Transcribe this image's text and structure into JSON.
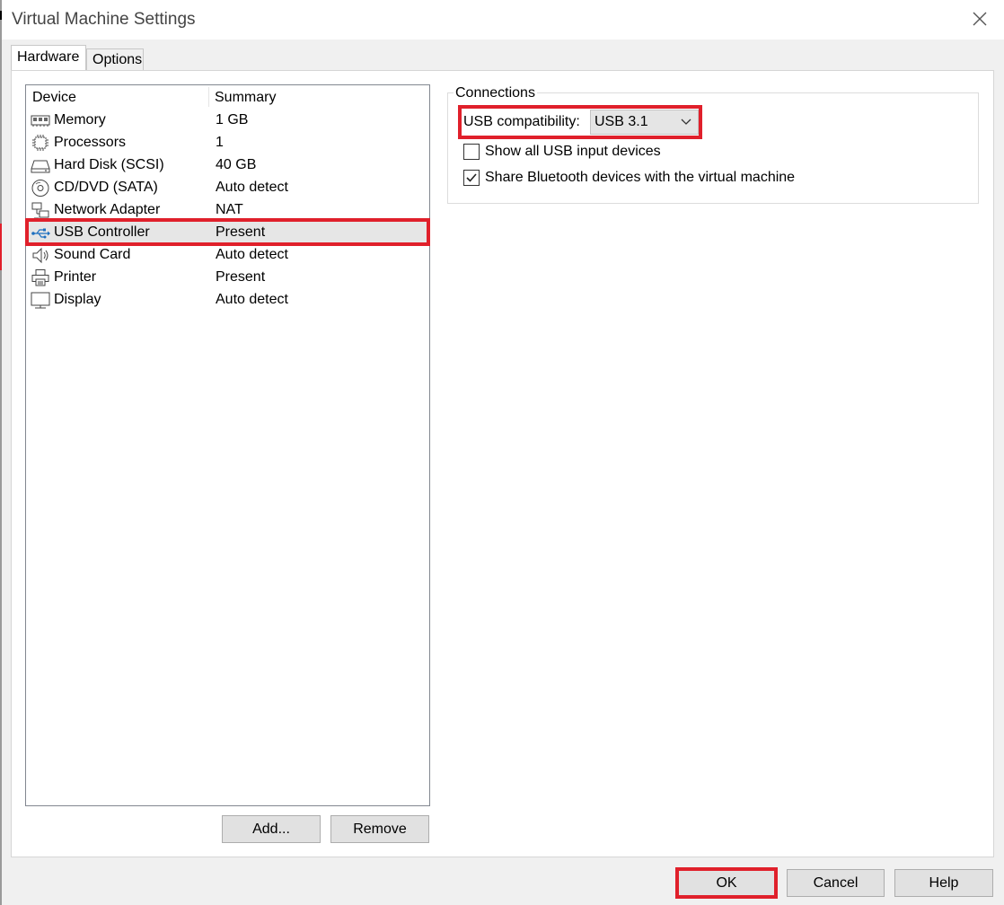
{
  "window": {
    "title": "Virtual Machine Settings"
  },
  "tabs": [
    {
      "label": "Hardware",
      "active": true
    },
    {
      "label": "Options",
      "active": false
    }
  ],
  "device_list": {
    "columns": [
      "Device",
      "Summary"
    ],
    "rows": [
      {
        "icon": "memory-icon",
        "name": "Memory",
        "summary": "1 GB"
      },
      {
        "icon": "processor-icon",
        "name": "Processors",
        "summary": "1"
      },
      {
        "icon": "hard-disk-icon",
        "name": "Hard Disk (SCSI)",
        "summary": "40 GB"
      },
      {
        "icon": "cd-dvd-icon",
        "name": "CD/DVD (SATA)",
        "summary": "Auto detect"
      },
      {
        "icon": "network-icon",
        "name": "Network Adapter",
        "summary": "NAT"
      },
      {
        "icon": "usb-icon",
        "name": "USB Controller",
        "summary": "Present",
        "selected": true
      },
      {
        "icon": "speaker-icon",
        "name": "Sound Card",
        "summary": "Auto detect"
      },
      {
        "icon": "printer-icon",
        "name": "Printer",
        "summary": "Present"
      },
      {
        "icon": "display-icon",
        "name": "Display",
        "summary": "Auto detect"
      }
    ]
  },
  "list_buttons": {
    "add": "Add...",
    "remove": "Remove"
  },
  "connections": {
    "title": "Connections",
    "usb_compat_label": "USB compatibility:",
    "usb_compat_value": "USB 3.1",
    "show_all_usb_label": "Show all USB input devices",
    "show_all_usb_checked": false,
    "share_bluetooth_label": "Share Bluetooth devices with the virtual machine",
    "share_bluetooth_checked": true
  },
  "footer": {
    "ok": "OK",
    "cancel": "Cancel",
    "help": "Help"
  },
  "colors": {
    "highlight": "#e0202b",
    "usb_icon": "#1e6fbf"
  }
}
